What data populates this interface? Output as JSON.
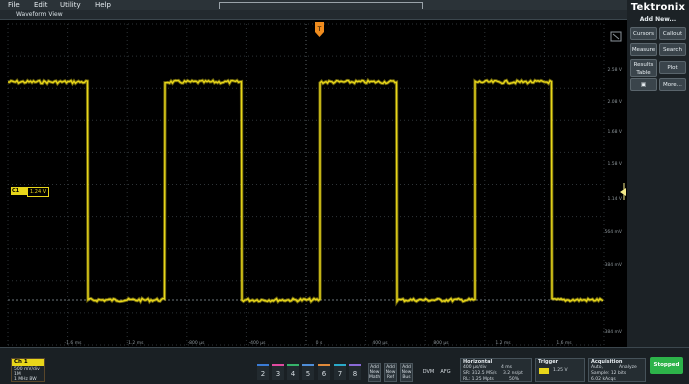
{
  "menu": [
    "File",
    "Edit",
    "Utility",
    "Help"
  ],
  "view_title": "Waveform View",
  "brand": "Tektronix",
  "side_panel": {
    "add_new": "Add New...",
    "buttons": [
      "Cursors",
      "Callout",
      "Measure",
      "Search",
      "Results Table",
      "Plot",
      "More..."
    ]
  },
  "y_labels": [
    "2.58 V",
    "2.08 V",
    "1.68 V",
    "1.58 V",
    "1.14 V",
    "564 mV",
    "384 mV",
    "-384 mV"
  ],
  "x_labels": [
    "-1.6 ms",
    "-1.2 ms",
    "-800 µs",
    "-400 µs",
    "0 s",
    "400 µs",
    "800 µs",
    "1.2 ms",
    "1.6 ms"
  ],
  "channel_marker": {
    "label": "C1",
    "level": "1.24 V"
  },
  "ch1": {
    "title": "Ch 1",
    "lines": [
      "500 mV/div",
      "1M",
      "1 MHz BW"
    ]
  },
  "channel_buttons": [
    "2",
    "3",
    "4",
    "5",
    "6",
    "7",
    "8"
  ],
  "add_buttons": [
    [
      "Add",
      "New",
      "Math"
    ],
    [
      "Add",
      "New",
      "Ref"
    ],
    [
      "Add",
      "New",
      "Bus"
    ]
  ],
  "extra_buttons": [
    "DVM",
    "AFG"
  ],
  "horizontal": {
    "title": "Horizontal",
    "lines": [
      "400 µs/div",
      "4 ms",
      "SR: 312.5 MS/s",
      "3.2 ns/pt",
      "RL: 1.25 Mpts",
      "50%"
    ]
  },
  "trigger": {
    "title": "Trigger",
    "level": "1.25 V"
  },
  "acquisition": {
    "title": "Acquisition",
    "lines": [
      "Auto,",
      "Analyze",
      "Sample: 12 bits",
      "6.02 kAcqs"
    ]
  },
  "run_button": "Stopped",
  "colors": {
    "trace": "#e8d61a",
    "run": "#2db34a",
    "trigger_marker": "#f08c1e"
  }
}
